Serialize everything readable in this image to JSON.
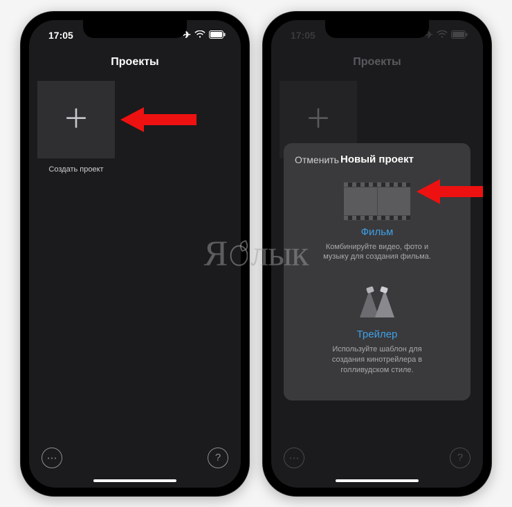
{
  "status": {
    "time": "17:05",
    "icons": {
      "airplane": "✈",
      "wifi": "wifi",
      "battery": "battery"
    }
  },
  "left": {
    "title": "Проекты",
    "create_tile_caption": "Создать проект"
  },
  "right": {
    "title": "Проекты",
    "sheet": {
      "cancel": "Отменить",
      "title": "Новый проект",
      "movie": {
        "title": "Фильм",
        "desc": "Комбинируйте видео, фото и\nмузыку для создания фильма."
      },
      "trailer": {
        "title": "Трейлер",
        "desc": "Используйте шаблон для\nсоздания кинотрейлера в\nголливудском стиле."
      }
    }
  },
  "bottom_icons": {
    "more": "⋯",
    "help": "?"
  },
  "watermark": "Я лык"
}
